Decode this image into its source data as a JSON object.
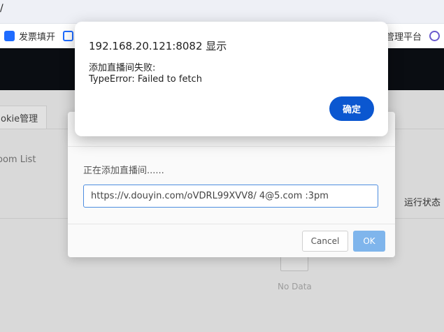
{
  "url_bar": {
    "text": "/"
  },
  "bookmarks": [
    {
      "label": "发票填开",
      "icon": "invoice-icon"
    },
    {
      "label": "",
      "icon": "bookmark-app-icon"
    },
    {
      "label": "管理平台",
      "icon": "admin-platform-icon"
    },
    {
      "label": "",
      "icon": "extension-icon"
    }
  ],
  "page": {
    "tab_label": "okie管理",
    "room_list_label": "oom List",
    "status_column": "运行状态",
    "empty_text": "No Data"
  },
  "modal": {
    "message": "正在添加直播间......",
    "input_value": "https://v.douyin.com/oVDRL99XVV8/ 4@5.com :3pm",
    "cancel_label": "Cancel",
    "ok_label": "OK"
  },
  "alert": {
    "title": "192.168.20.121:8082 显示",
    "line1": "添加直播间失败:",
    "line2": "TypeError: Failed to fetch",
    "confirm_label": "确定"
  },
  "colors": {
    "alert_button": "#0b57d0",
    "modal_ok": "#7fb5ec",
    "input_border": "#4d8de0",
    "header_dark": "#0a0d12"
  }
}
